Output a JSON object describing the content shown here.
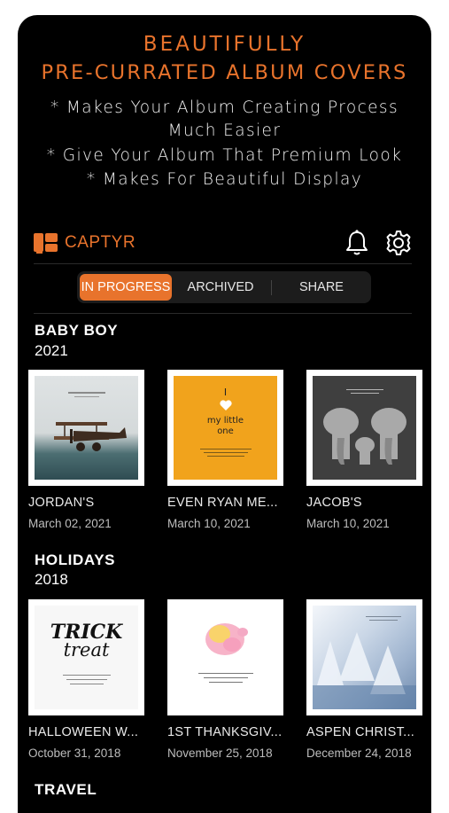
{
  "promo": {
    "headline_line1": "BEAUTIFULLY",
    "headline_line2": "PRE-CURRATED ALBUM COVERS",
    "bullets": [
      "* Makes Your Album Creating Process",
      "Much Easier",
      "* Give Your Album That Premium Look",
      "* Makes For Beautiful Display"
    ]
  },
  "header": {
    "brand": "CAPTYR",
    "icons": [
      "bell-icon",
      "gear-icon"
    ]
  },
  "tabs": [
    {
      "label": "IN PROGRESS",
      "active": true
    },
    {
      "label": "ARCHIVED",
      "active": false
    },
    {
      "label": "SHARE",
      "active": false
    }
  ],
  "sections": [
    {
      "title": "BABY BOY",
      "year": "2021",
      "albums": [
        {
          "title": "JORDAN'S",
          "date": "March 02, 2021",
          "cover": "Biplane"
        },
        {
          "title": "EVEN RYAN ME...",
          "date": "March 10, 2021",
          "cover": "my little one"
        },
        {
          "title": "JACOB'S",
          "date": "March 10, 2021",
          "cover": "Elephants"
        }
      ]
    },
    {
      "title": "HOLIDAYS",
      "year": "2018",
      "albums": [
        {
          "title": "HALLOWEEN  W...",
          "date": "October 31, 2018",
          "cover": "TRICK treat"
        },
        {
          "title": "1ST THANKSGIV...",
          "date": "November 25, 2018",
          "cover": "Turkey"
        },
        {
          "title": "ASPEN CHRIST...",
          "date": "December 24, 2018",
          "cover": "Snowy trees"
        }
      ]
    },
    {
      "title": "TRAVEL"
    }
  ],
  "colors": {
    "accent": "#e8732c",
    "background": "#000000"
  }
}
